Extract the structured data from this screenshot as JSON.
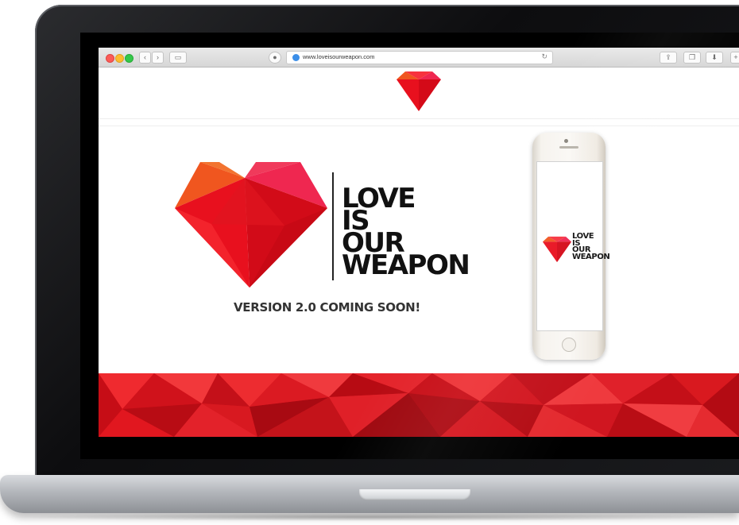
{
  "browser": {
    "url": "www.loveisourweapon.com",
    "tab_back_icon": "chevron-left-icon",
    "tab_forward_icon": "chevron-right-icon"
  },
  "site": {
    "title_lines": [
      "LOVE",
      "IS",
      "OUR",
      "WEAPON"
    ],
    "tagline": "VERSION 2.0 COMING SOON!"
  },
  "phone": {
    "title_lines": [
      "LOVE",
      "IS",
      "OUR",
      "WEAPON"
    ]
  },
  "colors": {
    "brand_red": "#e8101e",
    "brand_orange": "#f0561f",
    "brand_pink": "#ef2750"
  }
}
